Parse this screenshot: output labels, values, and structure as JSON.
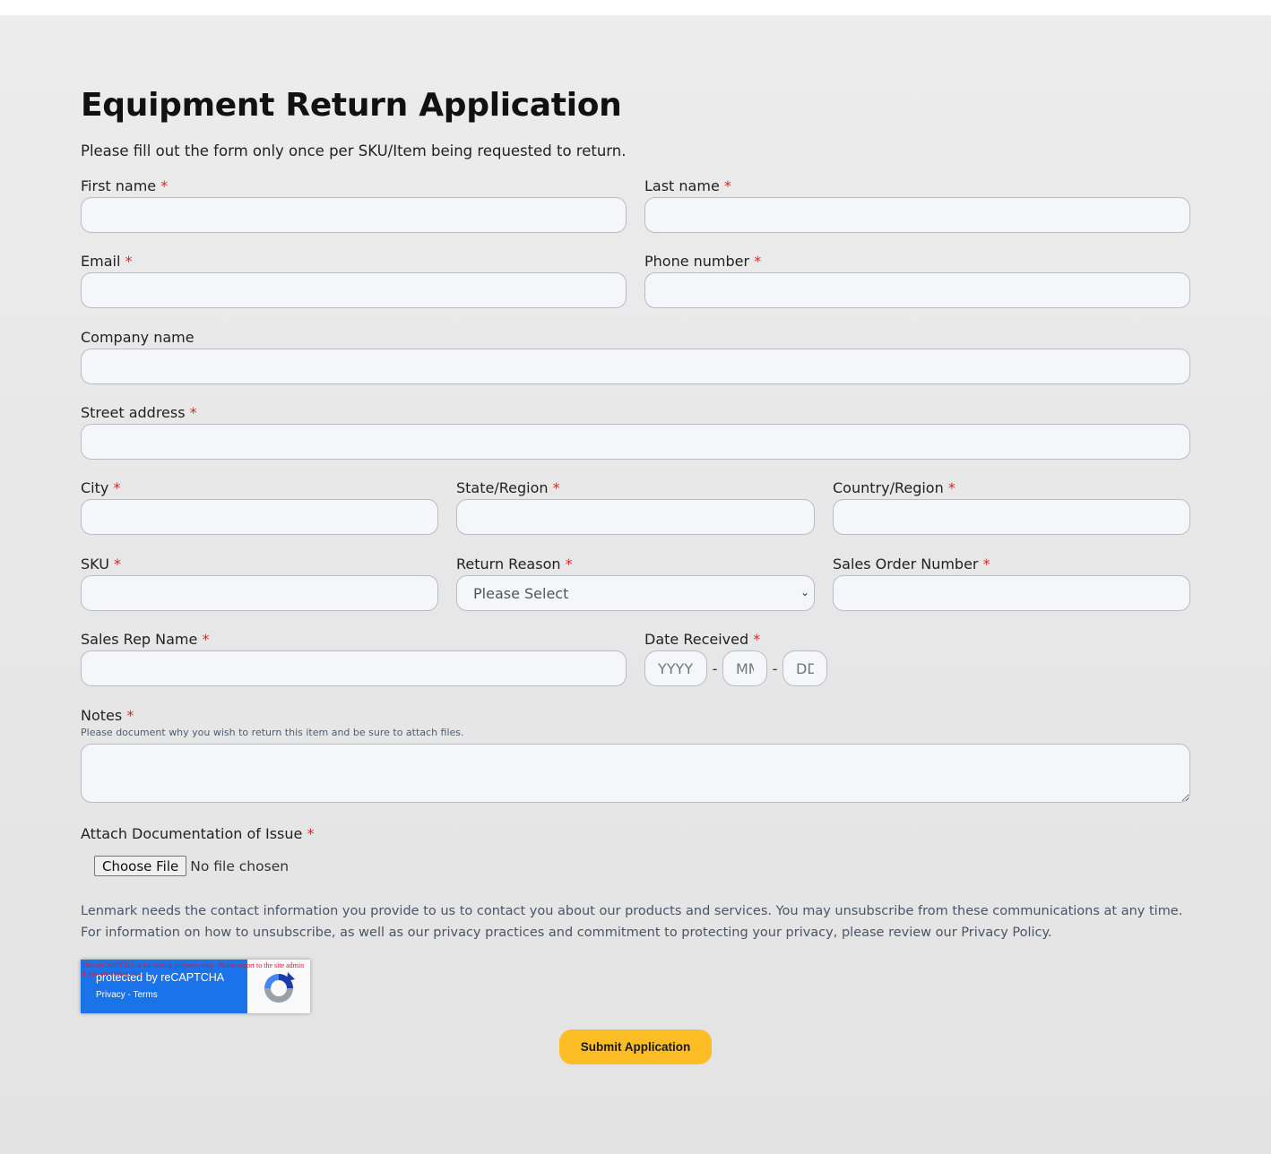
{
  "form": {
    "title": "Equipment Return Application",
    "intro": "Please fill out the form only once per SKU/Item being requested to return.",
    "required_marker": "*",
    "fields": {
      "first_name": {
        "label": "First name",
        "value": ""
      },
      "last_name": {
        "label": "Last name",
        "value": ""
      },
      "email": {
        "label": "Email",
        "value": ""
      },
      "phone": {
        "label": "Phone number",
        "value": ""
      },
      "company": {
        "label": "Company name",
        "value": ""
      },
      "street": {
        "label": "Street address",
        "value": ""
      },
      "city": {
        "label": "City",
        "value": ""
      },
      "state": {
        "label": "State/Region",
        "value": ""
      },
      "country": {
        "label": "Country/Region",
        "value": ""
      },
      "sku": {
        "label": "SKU",
        "value": ""
      },
      "return_reason": {
        "label": "Return Reason",
        "selected": "Please Select"
      },
      "sales_order": {
        "label": "Sales Order Number",
        "value": ""
      },
      "sales_rep": {
        "label": "Sales Rep Name",
        "value": ""
      },
      "date_received": {
        "label": "Date Received",
        "year_placeholder": "YYYY",
        "month_placeholder": "MM",
        "day_placeholder": "DD",
        "separator": "-"
      },
      "notes": {
        "label": "Notes",
        "help": "Please document why you wish to return this item and be sure to attach files.",
        "value": ""
      },
      "attachment": {
        "label": "Attach Documentation of Issue",
        "button_label": "Choose File",
        "status": "No file chosen"
      }
    },
    "legal": "Lenmark needs the contact information you provide to us to contact you about our products and services. You may unsubscribe from these communications at any time. For information on how to unsubscribe, as well as our privacy practices and commitment to protecting your privacy, please review our Privacy Policy.",
    "recaptcha": {
      "warning": "This reCAPTCHA is for testing purposes only. Please report to the site admin if you are seeing this.",
      "title": "protected by reCAPTCHA",
      "links": "Privacy - Terms",
      "icon": "recaptcha-logo-icon"
    },
    "submit_label": "Submit Application",
    "colors": {
      "required": "#d42a2a",
      "submit": "#fdbd25",
      "recaptcha_blue": "#1a73e8"
    }
  }
}
